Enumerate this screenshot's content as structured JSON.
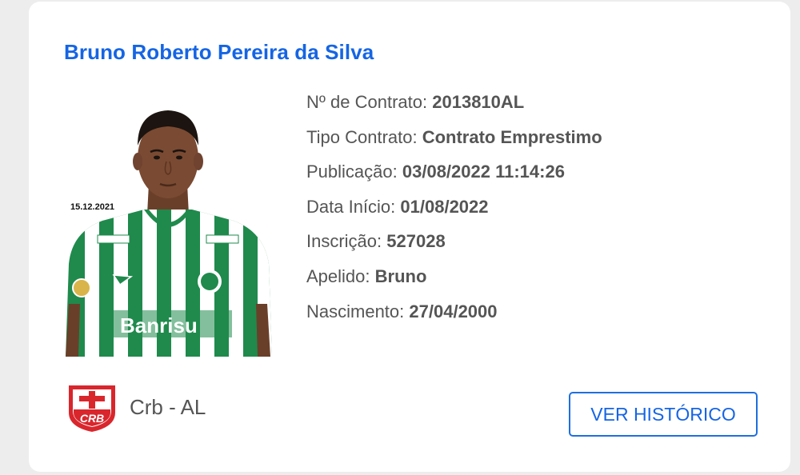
{
  "player": {
    "name": "Bruno Roberto Pereira da Silva",
    "photo_date": "15.12.2021",
    "shirt_sponsor": "Banrisu"
  },
  "details": [
    {
      "label": "Nº de Contrato:",
      "value": "2013810AL"
    },
    {
      "label": "Tipo Contrato:",
      "value": "Contrato Emprestimo"
    },
    {
      "label": "Publicação:",
      "value": "03/08/2022 11:14:26"
    },
    {
      "label": "Data Início:",
      "value": "01/08/2022"
    },
    {
      "label": "Inscrição:",
      "value": "527028"
    },
    {
      "label": "Apelido:",
      "value": "Bruno"
    },
    {
      "label": "Nascimento:",
      "value": "27/04/2000"
    }
  ],
  "club": {
    "logo_text": "CRB",
    "name": "Crb - AL"
  },
  "actions": {
    "history_label": "VER HISTÓRICO"
  },
  "colors": {
    "name_blue": "#1565e4",
    "text_gray": "#555555",
    "card_bg": "#ffffff",
    "page_bg": "#ededed",
    "crb_red": "#d9262c",
    "jersey_green": "#1f8a4c"
  }
}
